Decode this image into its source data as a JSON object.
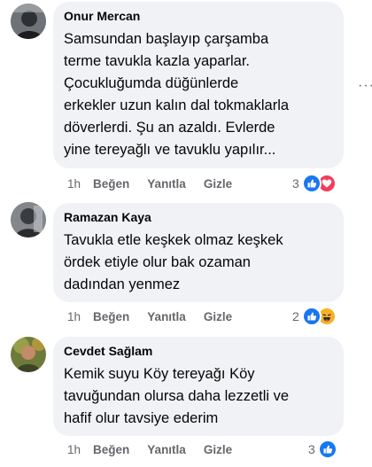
{
  "comments": [
    {
      "author": "Onur Mercan",
      "text_lines": [
        "Samsundan başlayıp çarşamba",
        "terme tavukla kazla yaparlar.",
        "Çocukluğumda düğünlerde",
        "erkekler uzun kalın dal tokmaklarla",
        "döverlerdi. Şu an azaldı. Evlerde",
        "yine tereyağlı ve tavuklu yapılır..."
      ],
      "time": "1h",
      "like": "Beğen",
      "reply": "Yanıtla",
      "hide": "Gizle",
      "reaction_count": "3",
      "reactions": [
        "like-icon",
        "love-icon"
      ]
    },
    {
      "author": "Ramazan Kaya",
      "text_lines": [
        "Tavukla etle keşkek olmaz keşkek",
        "ördek etiyle olur bak ozaman",
        "dadından yenmez"
      ],
      "time": "1h",
      "like": "Beğen",
      "reply": "Yanıtla",
      "hide": "Gizle",
      "reaction_count": "2",
      "reactions": [
        "like-icon",
        "haha-icon"
      ]
    },
    {
      "author": "Cevdet Sağlam",
      "text_lines": [
        "Kemik suyu Köy tereyağı Köy",
        "tavuğundan olursa daha lezzetli ve",
        "hafif olur tavsiye ederim"
      ],
      "time": "1h",
      "like": "Beğen",
      "reply": "Yanıtla",
      "hide": "Gizle",
      "reaction_count": "3",
      "reactions": [
        "like-icon"
      ]
    }
  ],
  "more_options": "···"
}
